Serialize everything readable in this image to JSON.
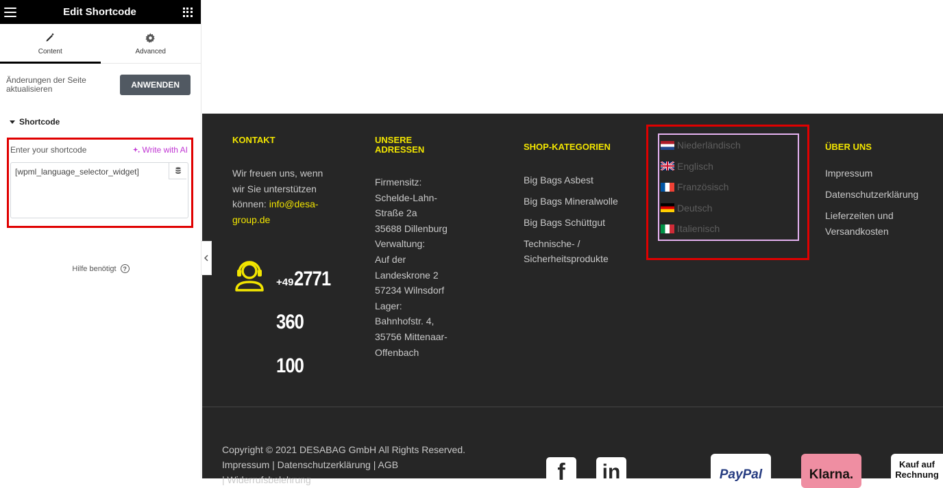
{
  "panel": {
    "title": "Edit Shortcode",
    "tabs": [
      {
        "label": "Content",
        "icon": "pencil-icon",
        "active": true
      },
      {
        "label": "Advanced",
        "icon": "gear-icon",
        "active": false
      }
    ],
    "apply_text": "Änderungen der Seite aktualisieren",
    "apply_button": "ANWENDEN",
    "section_title": "Shortcode",
    "shortcode_label": "Enter your shortcode",
    "write_ai": "Write with AI",
    "shortcode_value": "[wpml_language_selector_widget]",
    "help": "Hilfe benötigt"
  },
  "footer": {
    "kontakt": {
      "title": "KONTAKT",
      "text": "Wir freuen uns, wenn wir Sie unterstützen können:",
      "email": "info@desa-group.de",
      "phone_prefix": "+49",
      "phone_parts": [
        "2771",
        "360",
        "100"
      ]
    },
    "adressen": {
      "title_line1": "UNSERE",
      "title_line2": "ADRESSEN",
      "lines": [
        "Firmensitz:",
        "Schelde-Lahn-",
        "Straße 2a",
        "35688 Dillenburg",
        "Verwaltung:",
        "Auf der",
        "Landeskrone 2",
        "57234 Wilnsdorf",
        "Lager:",
        "Bahnhofstr. 4,",
        "35756 Mittenaar-",
        "Offenbach"
      ]
    },
    "shop": {
      "title": "SHOP-KATEGORIEN",
      "items": [
        "Big Bags Asbest",
        "Big Bags Mineralwolle",
        "Big Bags Schüttgut",
        "Technische- /",
        "Sicherheitsprodukte"
      ]
    },
    "languages": [
      {
        "label": "Niederländisch",
        "flag": "nl"
      },
      {
        "label": "Englisch",
        "flag": "gb"
      },
      {
        "label": "Französisch",
        "flag": "fr"
      },
      {
        "label": "Deutsch",
        "flag": "de"
      },
      {
        "label": "Italienisch",
        "flag": "it"
      }
    ],
    "ueber": {
      "title": "ÜBER UNS",
      "items": [
        "Impressum",
        "Datenschutzerklärung",
        "Lieferzeiten und",
        "Versandkosten"
      ]
    },
    "copyright_line1": "Copyright © 2021 DESABAG GmbH All Rights Reserved.",
    "copyright_line2": "Impressum | Datenschutzerklärung | AGB",
    "copyright_line3": "| Widerrufsbelehrung",
    "social": [
      {
        "icon": "facebook-icon",
        "glyph": "f"
      },
      {
        "icon": "linkedin-icon",
        "glyph": "in"
      }
    ],
    "payments": [
      {
        "label": "PayPal"
      },
      {
        "label": "Klarna."
      },
      {
        "label": "Kauf auf Rechnung"
      }
    ]
  },
  "colors": {
    "accent": "#f2e500",
    "footer_bg": "#262626",
    "highlight": "#e00000",
    "ai": "#c036d3"
  }
}
